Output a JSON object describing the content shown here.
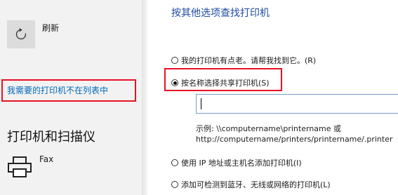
{
  "left_pane": {
    "refresh_label": "刷新",
    "missing_printer_link": "我需要的打印机不在列表中",
    "section_heading": "打印机和扫描仪",
    "device_name": "Fax"
  },
  "dialog": {
    "title": "按其他选项查找打印机",
    "options": [
      {
        "label": "我的打印机有点老。请帮我找到它。(R)",
        "selected": false
      },
      {
        "label": "按名称选择共享打印机(S)",
        "selected": true
      },
      {
        "label": "使用 IP 地址或主机名添加打印机(I)",
        "selected": false
      },
      {
        "label": "添加可检测到蓝牙、无线或网络的打印机(L)",
        "selected": false
      }
    ],
    "name_input_value": "",
    "example_line1": "示例: \\\\computername\\printername 或",
    "example_line2": "http://computername/printers/printername/.printer"
  },
  "colors": {
    "highlight": "#e81123",
    "link": "#0067b8",
    "title": "#1f4ca0"
  },
  "icons": [
    "refresh-icon",
    "printer-icon"
  ]
}
